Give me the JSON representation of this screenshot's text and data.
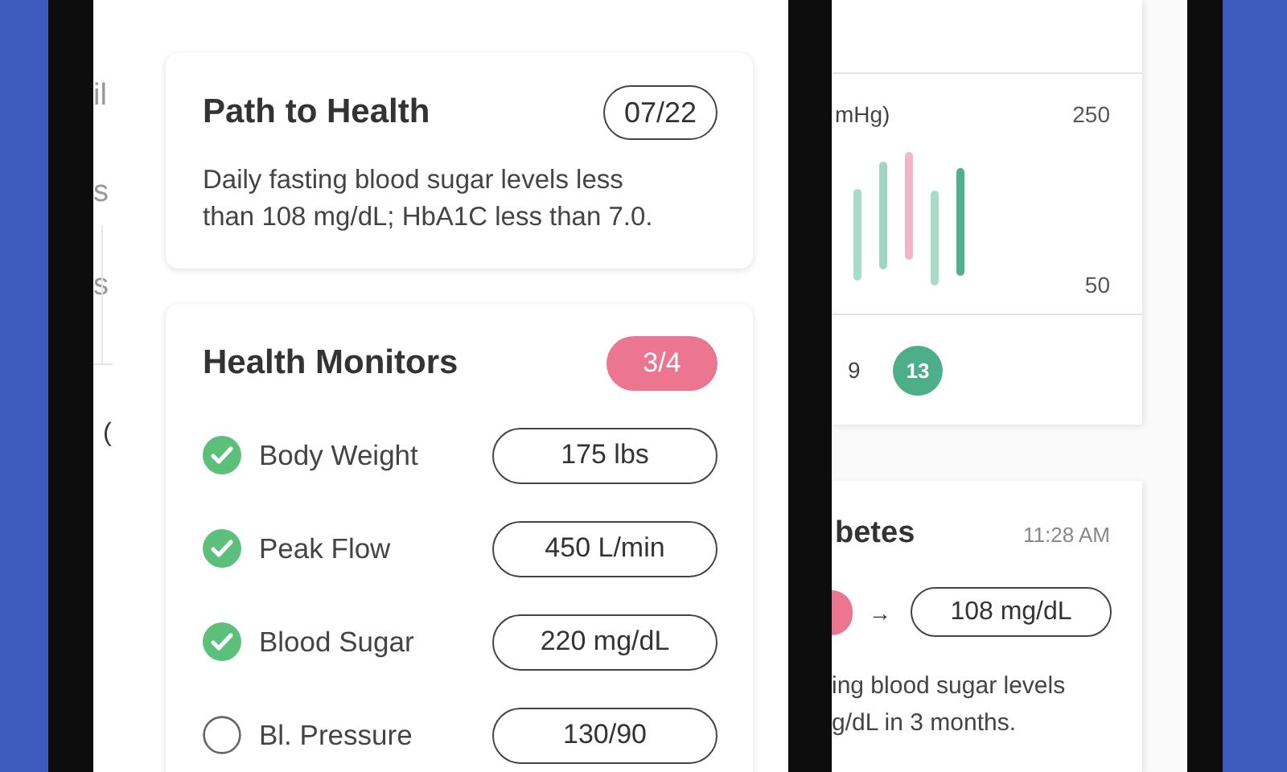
{
  "back_screen_fragments": [
    "il",
    "s",
    "s",
    "("
  ],
  "path_to_health": {
    "title": "Path to Health",
    "date": "07/22",
    "description": "Daily fasting blood sugar levels less than 108 mg/dL; HbA1C less than 7.0."
  },
  "health_monitors": {
    "title": "Health Monitors",
    "count": "3/4",
    "items": [
      {
        "label": "Body Weight",
        "value": "175 lbs",
        "checked": true
      },
      {
        "label": "Peak Flow",
        "value": "450 L/min",
        "checked": true
      },
      {
        "label": "Blood Sugar",
        "value": "220 mg/dL",
        "checked": true
      },
      {
        "label": "Bl. Pressure",
        "value": "130/90",
        "checked": false
      }
    ]
  },
  "right_screen": {
    "chart": {
      "unit_label": "mHg)",
      "top_label": "250",
      "bottom_label": "50"
    },
    "dates": [
      {
        "label": "9",
        "selected": false
      },
      {
        "label": "13",
        "selected": true
      }
    ],
    "goal_card": {
      "title": "betes",
      "time": "11:28 AM",
      "arrow": "→",
      "target": "108 mg/dL",
      "description_lines": [
        "ing blood sugar levels",
        "g/dL in 3 months."
      ]
    }
  }
}
